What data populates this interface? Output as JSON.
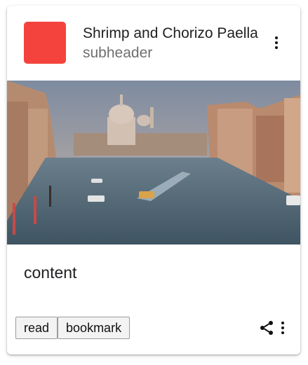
{
  "header": {
    "avatar_color": "#f4433c",
    "title": "Shrimp and Chorizo Paella",
    "subtitle": "subheader",
    "menu_icon": "more-vert-icon"
  },
  "media": {
    "alt": "Grand Canal in Venice with boats and domed church",
    "colors": {
      "sky_top": "#7e8ba0",
      "sky_bottom": "#c9b7a6",
      "water": "#4d6270",
      "water_highlight": "#79909e",
      "buildings_left": "#b58b70",
      "buildings_right": "#b98a6e",
      "dome": "#d8c8bc"
    }
  },
  "content": {
    "text": "content"
  },
  "actions": {
    "read_label": "read",
    "bookmark_label": "bookmark",
    "share_icon": "share-icon",
    "more_icon": "more-vert-icon"
  }
}
